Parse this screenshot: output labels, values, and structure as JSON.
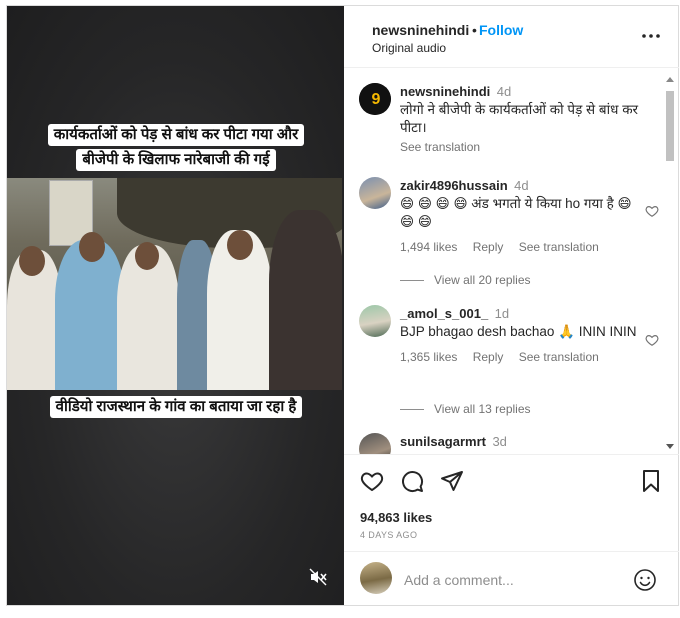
{
  "video": {
    "caption_top": [
      "कार्यकर्ताओं को पेड़ से बांध कर पीटा गया और",
      "बीजेपी के खिलाफ नारेबाजी की गई"
    ],
    "caption_bottom": "वीडियो राजस्थान के गांव का बताया जा रहा है",
    "mute_icon": "speaker-muted-icon"
  },
  "header": {
    "username": "newsninehindi",
    "separator": "•",
    "follow_label": "Follow",
    "audio_label": "Original audio",
    "more_icon": "ellipsis-icon"
  },
  "comments": [
    {
      "username": "newsninehindi",
      "time": "4d",
      "text": "लोगो ने बीजेपी के कार्यकर्ताओं को पेड़ से बांध कर पीटा।",
      "translation": "See translation"
    },
    {
      "username": "zakir4896hussain",
      "time": "4d",
      "text_prefix": "😄 😄 😄 😄 ",
      "text": "अंड भगतो ये किया ho गया है 😄 😄 😄",
      "likes": "1,494 likes",
      "reply": "Reply",
      "translation": "See translation",
      "view_replies": "View all 20 replies"
    },
    {
      "username": "_amol_s_001_",
      "time": "1d",
      "text": "BJP bhagao desh bachao 🙏 ININ ININ",
      "likes": "1,365 likes",
      "reply": "Reply",
      "translation": "See translation",
      "view_replies": "View all 13 replies"
    },
    {
      "username": "sunilsagarmrt",
      "time": "3d",
      "text": ""
    }
  ],
  "actions": {
    "like_icon": "heart-icon",
    "comment_icon": "comment-icon",
    "share_icon": "share-icon",
    "save_icon": "bookmark-icon",
    "likes": "94,863 likes",
    "age": "4 DAYS AGO"
  },
  "add_comment": {
    "placeholder": "Add a comment...",
    "emoji_icon": "emoji-icon"
  },
  "colors": {
    "accent": "#0095f6",
    "muted_text": "#737373",
    "media_bg": "#252526"
  }
}
